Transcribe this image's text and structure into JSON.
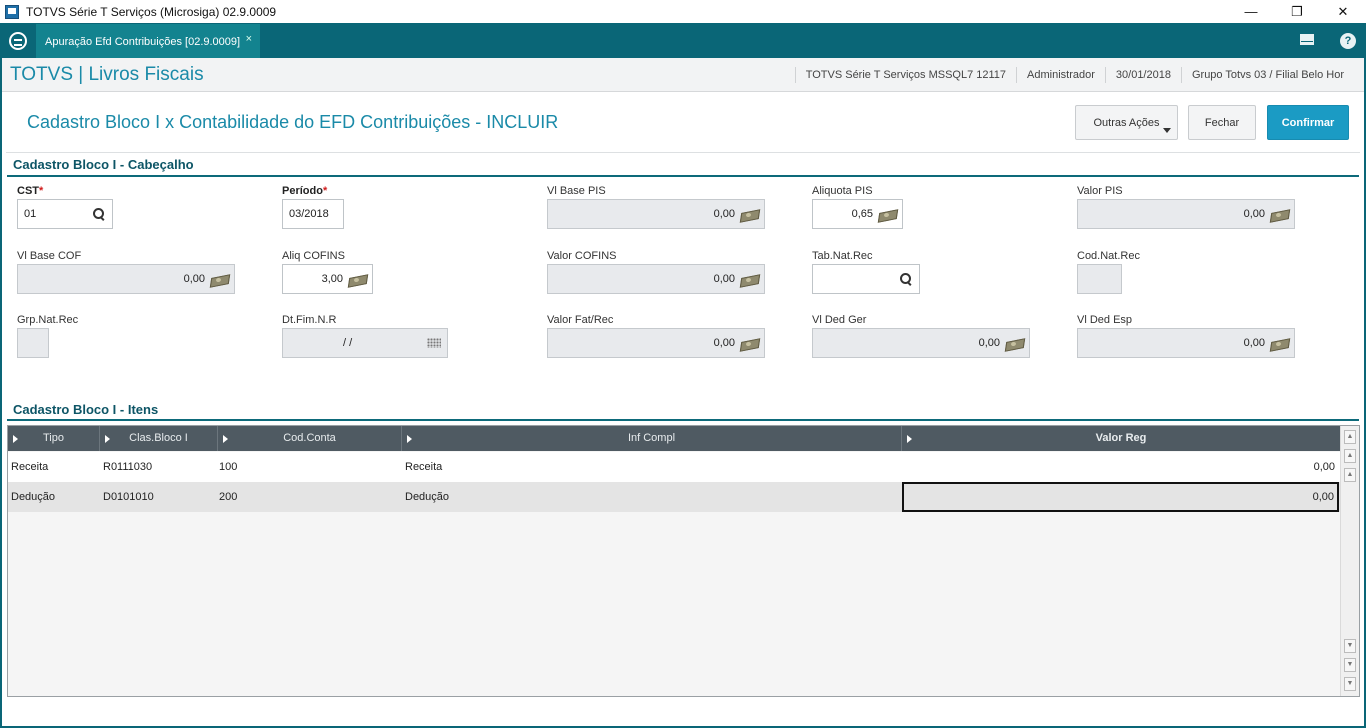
{
  "window": {
    "title": "TOTVS Série T Serviços (Microsiga) 02.9.0009",
    "minimize": "—",
    "maximize": "❐",
    "close": "✕"
  },
  "tabbar": {
    "active_tab": "Apuração Efd Contribuições [02.9.0009]",
    "tab_close": "×",
    "help": "?"
  },
  "header": {
    "brand": "TOTVS | Livros Fiscais",
    "environment": "TOTVS Série T Serviços MSSQL7 12117",
    "user": "Administrador",
    "date": "30/01/2018",
    "branch": "Grupo Totvs 03 / Filial Belo Hor"
  },
  "page": {
    "title": "Cadastro Bloco I x Contabilidade do EFD Contribuições - INCLUIR",
    "outras_acoes": "Outras Ações",
    "fechar": "Fechar",
    "confirmar": "Confirmar"
  },
  "section_header": {
    "title": "Cadastro Bloco I - Cabeçalho"
  },
  "fields": {
    "cst": {
      "label": "CST",
      "required": "*",
      "value": "01"
    },
    "periodo": {
      "label": "Período",
      "required": "*",
      "value": "03/2018"
    },
    "vl_base_pis": {
      "label": "Vl Base PIS",
      "value": "0,00"
    },
    "aliquota_pis": {
      "label": "Aliquota PIS",
      "value": "0,65"
    },
    "valor_pis": {
      "label": "Valor PIS",
      "value": "0,00"
    },
    "vl_base_cof": {
      "label": "Vl Base COF",
      "value": "0,00"
    },
    "aliq_cofins": {
      "label": "Aliq COFINS",
      "value": "3,00"
    },
    "valor_cofins": {
      "label": "Valor COFINS",
      "value": "0,00"
    },
    "tab_nat_rec": {
      "label": "Tab.Nat.Rec",
      "value": ""
    },
    "cod_nat_rec": {
      "label": "Cod.Nat.Rec",
      "value": ""
    },
    "grp_nat_rec": {
      "label": "Grp.Nat.Rec",
      "value": ""
    },
    "dt_fim_nr": {
      "label": "Dt.Fim.N.R",
      "value": "/ /"
    },
    "valor_fat_rec": {
      "label": "Valor Fat/Rec",
      "value": "0,00"
    },
    "vl_ded_ger": {
      "label": "Vl Ded Ger",
      "value": "0,00"
    },
    "vl_ded_esp": {
      "label": "Vl Ded Esp",
      "value": "0,00"
    }
  },
  "section_items": {
    "title": "Cadastro Bloco I - Itens"
  },
  "grid": {
    "columns": [
      "Tipo",
      "Clas.Bloco I",
      "Cod.Conta",
      "Inf Compl",
      "Valor Reg"
    ],
    "rows": [
      {
        "tipo": "Receita",
        "clas": "R0111030",
        "cod": "100",
        "inf": "Receita",
        "valor": "0,00"
      },
      {
        "tipo": "Dedução",
        "clas": "D0101010",
        "cod": "200",
        "inf": "Dedução",
        "valor": "0,00"
      }
    ]
  },
  "colors": {
    "tabbar": "#0a6677",
    "brand": "#1a8aa8",
    "section": "#0d5566",
    "confirm": "#1b9bc4",
    "grid_header": "#4f5a62",
    "required": "#d01c1c"
  },
  "icons": [
    "app-icon",
    "totvs-logo-icon",
    "mail-icon",
    "help-icon",
    "search-icon",
    "money-icon",
    "calendar-icon",
    "caret-down-icon",
    "sort-arrow-icon",
    "scroll-up-icon",
    "scroll-down-icon"
  ]
}
